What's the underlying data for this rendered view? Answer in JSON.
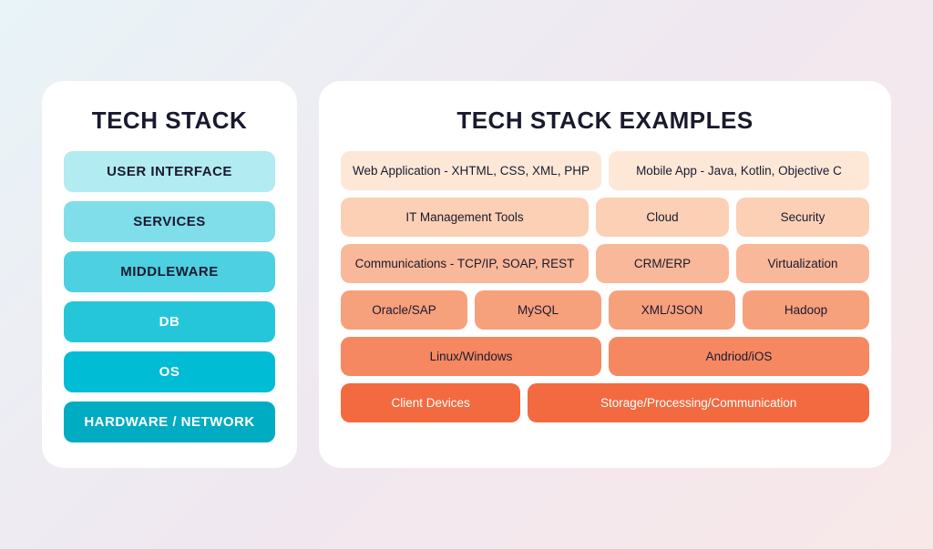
{
  "left": {
    "title": "TECH STACK",
    "items": [
      {
        "label": "USER INTERFACE",
        "colorClass": "ui-item"
      },
      {
        "label": "SERVICES",
        "colorClass": "svc-item"
      },
      {
        "label": "MIDDLEWARE",
        "colorClass": "mw-item"
      },
      {
        "label": "DB",
        "colorClass": "db-item"
      },
      {
        "label": "OS",
        "colorClass": "os-item"
      },
      {
        "label": "HARDWARE / NETWORK",
        "colorClass": "hw-item"
      }
    ]
  },
  "right": {
    "title": "TECH STACK EXAMPLES",
    "rows": [
      {
        "cells": [
          {
            "label": "Web Application - XHTML, CSS, XML, PHP",
            "flex": "flex-2",
            "color": "c1"
          },
          {
            "label": "Mobile App - Java, Kotlin, Objective C",
            "flex": "flex-2",
            "color": "c1"
          }
        ]
      },
      {
        "cells": [
          {
            "label": "IT Management Tools",
            "flex": "flex-2",
            "color": "c2"
          },
          {
            "label": "Cloud",
            "flex": "flex-1",
            "color": "c2"
          },
          {
            "label": "Security",
            "flex": "flex-1",
            "color": "c2"
          }
        ]
      },
      {
        "cells": [
          {
            "label": "Communications - TCP/IP, SOAP, REST",
            "flex": "flex-2",
            "color": "c3"
          },
          {
            "label": "CRM/ERP",
            "flex": "flex-1",
            "color": "c3"
          },
          {
            "label": "Virtualization",
            "flex": "flex-1",
            "color": "c3"
          }
        ]
      },
      {
        "cells": [
          {
            "label": "Oracle/SAP",
            "flex": "flex-1",
            "color": "c4"
          },
          {
            "label": "MySQL",
            "flex": "flex-1",
            "color": "c4"
          },
          {
            "label": "XML/JSON",
            "flex": "flex-1",
            "color": "c4"
          },
          {
            "label": "Hadoop",
            "flex": "flex-1",
            "color": "c4"
          }
        ]
      },
      {
        "cells": [
          {
            "label": "Linux/Windows",
            "flex": "flex-1",
            "color": "c5"
          },
          {
            "label": "Andriod/iOS",
            "flex": "flex-1",
            "color": "c5"
          }
        ]
      },
      {
        "cells": [
          {
            "label": "Client Devices",
            "flex": "flex-1",
            "color": "c6"
          },
          {
            "label": "Storage/Processing/Communication",
            "flex": "flex-2",
            "color": "c6"
          }
        ]
      }
    ]
  }
}
